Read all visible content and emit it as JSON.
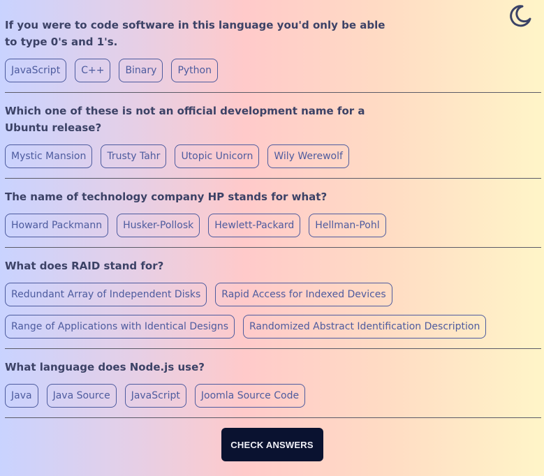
{
  "theme_toggle": {
    "icon": "moon-icon",
    "color": "#3a4266"
  },
  "questions": [
    {
      "text": "If you were to code software in this language you'd only be able to type 0's and 1's.",
      "answers": [
        "JavaScript",
        "C++",
        "Binary",
        "Python"
      ]
    },
    {
      "text": "Which one of these is not an official development name for a Ubuntu release?",
      "answers": [
        "Mystic Mansion",
        "Trusty Tahr",
        "Utopic Unicorn",
        "Wily Werewolf"
      ]
    },
    {
      "text": "The name of technology company HP stands for what?",
      "answers": [
        "Howard Packmann",
        "Husker-Pollosk",
        "Hewlett-Packard",
        "Hellman-Pohl"
      ]
    },
    {
      "text": "What does RAID stand for?",
      "answers": [
        "Redundant Array of Independent Disks",
        "Rapid Access for Indexed Devices",
        "Range of Applications with Identical Designs",
        "Randomized Abstract Identification Description"
      ]
    },
    {
      "text": "What language does Node.js use?",
      "answers": [
        "Java",
        "Java Source",
        "JavaScript",
        "Joomla Source Code"
      ]
    }
  ],
  "check_button": {
    "label": "CHECK ANSWERS"
  },
  "colors": {
    "text": "#3c4266",
    "answer_border": "#4d5b9e",
    "button_bg": "#0a1230",
    "button_text": "#f0f0f8"
  }
}
